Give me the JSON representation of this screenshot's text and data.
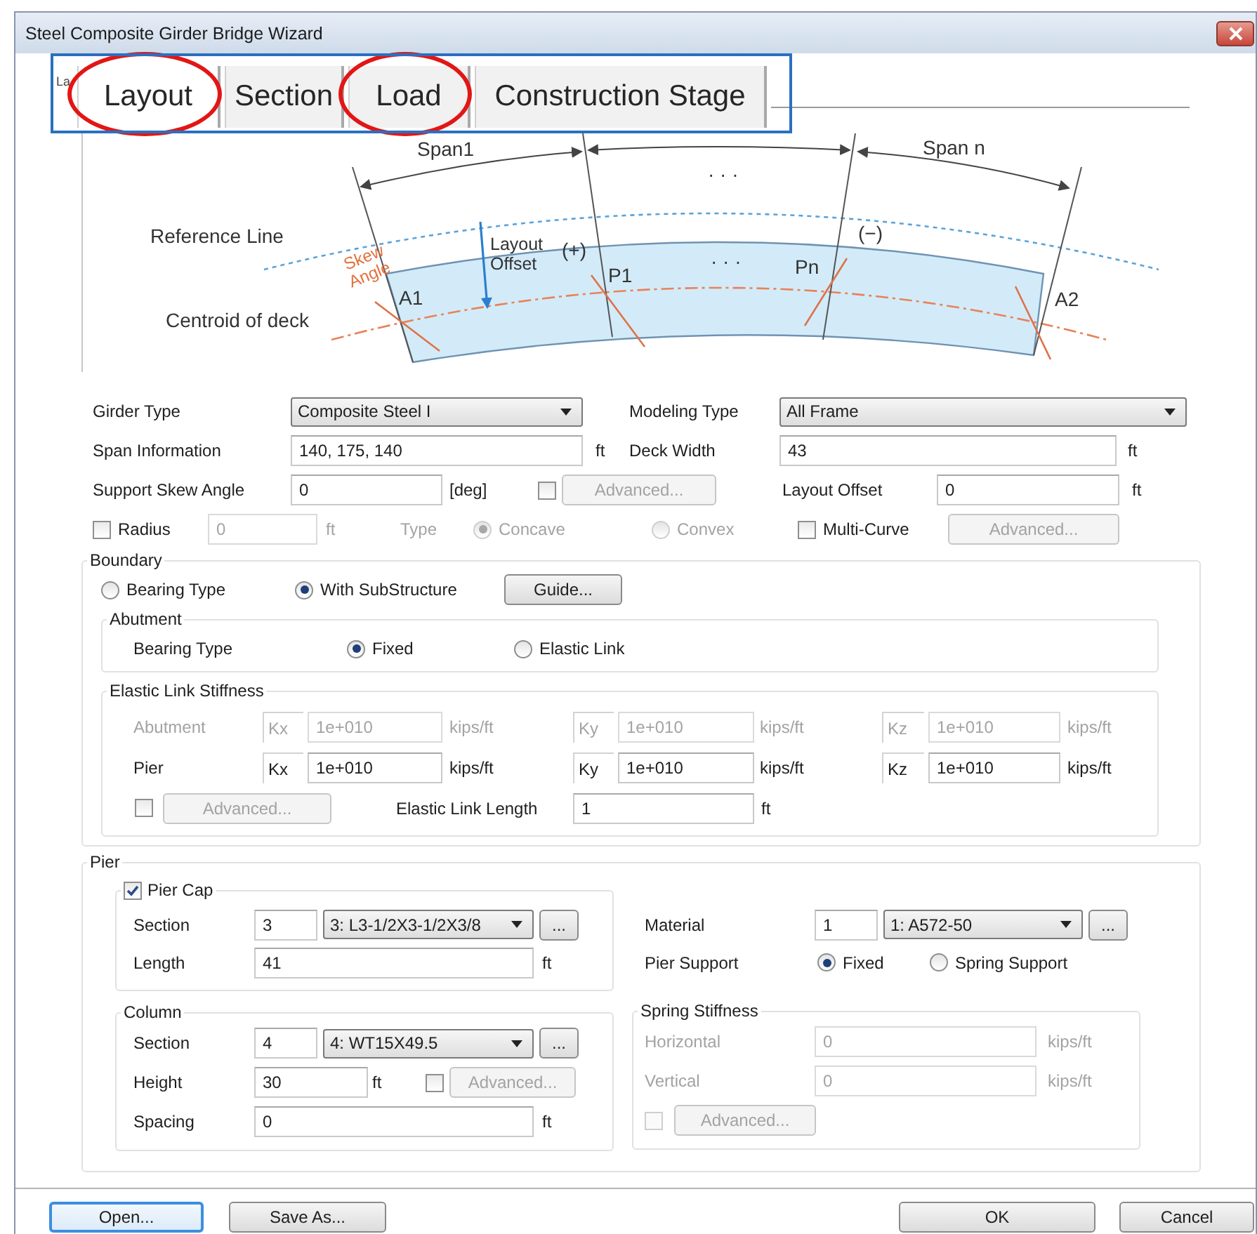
{
  "window": {
    "title": "Steel Composite Girder Bridge Wizard"
  },
  "tabs": {
    "hidden_tab_label": "La",
    "highlight_frame": true,
    "items": [
      {
        "label": "Layout",
        "selected": true,
        "circled": true
      },
      {
        "label": "Section",
        "selected": false,
        "circled": false
      },
      {
        "label": "Load",
        "selected": false,
        "circled": true
      },
      {
        "label": "Construction Stage",
        "selected": false,
        "circled": false
      }
    ]
  },
  "diagram": {
    "labels": [
      {
        "text": "Span1",
        "kind": "plain"
      },
      {
        "text": "· · ·",
        "kind": "plain"
      },
      {
        "text": "Span n",
        "kind": "plain"
      },
      {
        "text": "Reference Line",
        "kind": "plain"
      },
      {
        "text": "Layout Offset",
        "kind": "plain"
      },
      {
        "text": "(+)",
        "kind": "plain"
      },
      {
        "text": "P1",
        "kind": "plain"
      },
      {
        "text": "· · ·",
        "kind": "plain"
      },
      {
        "text": "Pn",
        "kind": "plain"
      },
      {
        "text": "(−)",
        "kind": "plain"
      },
      {
        "text": "Skew Angle",
        "kind": "angle"
      },
      {
        "text": "A1",
        "kind": "plain"
      },
      {
        "text": "A2",
        "kind": "plain"
      },
      {
        "text": "Centroid of deck",
        "kind": "plain"
      }
    ]
  },
  "general": {
    "rows": [
      {
        "cells": [
          {
            "kind": "label",
            "text": "Girder Type",
            "disabled": false
          },
          {
            "kind": "select",
            "value": "Composite Steel I",
            "disabled": false
          },
          {
            "kind": "blank"
          },
          {
            "kind": "blank"
          },
          {
            "kind": "blank"
          },
          {
            "kind": "label",
            "text": "Modeling Type",
            "disabled": false
          },
          {
            "kind": "select",
            "value": "All Frame",
            "disabled": false
          }
        ]
      },
      {
        "cells": [
          {
            "kind": "label",
            "text": "Span Information",
            "disabled": false
          },
          {
            "kind": "input",
            "value": "140, 175, 140",
            "disabled": false
          },
          {
            "kind": "blank"
          },
          {
            "kind": "blank"
          },
          {
            "kind": "label",
            "text": "ft",
            "disabled": false
          },
          {
            "kind": "label",
            "text": "Deck Width",
            "disabled": false
          },
          {
            "kind": "input",
            "value": "43",
            "disabled": false
          },
          {
            "kind": "blank"
          },
          {
            "kind": "label",
            "text": "ft",
            "disabled": false
          }
        ]
      },
      {
        "cells": [
          {
            "kind": "label",
            "text": "Support Skew Angle",
            "disabled": false
          },
          {
            "kind": "input",
            "value": "0",
            "disabled": false
          },
          {
            "kind": "label",
            "text": "[deg]",
            "disabled": false
          },
          {
            "kind": "checkbox",
            "checked": false,
            "disabled": false
          },
          {
            "kind": "button",
            "text": "Advanced...",
            "disabled": true
          },
          {
            "kind": "blank"
          },
          {
            "kind": "label",
            "text": "Layout Offset",
            "disabled": false
          },
          {
            "kind": "input",
            "value": "0",
            "disabled": false
          },
          {
            "kind": "label",
            "text": "ft",
            "disabled": false
          }
        ]
      }
    ],
    "curve_options": {
      "cells": [
        {
          "kind": "checkbox",
          "text": "Radius",
          "checked": false,
          "disabled": false
        },
        {
          "kind": "input",
          "value": "0",
          "disabled": true
        },
        {
          "kind": "label",
          "text": "ft",
          "disabled": true
        },
        {
          "kind": "label",
          "text": "Type",
          "disabled": true
        },
        {
          "kind": "radio",
          "text": "Concave",
          "selected": true,
          "disabled": true
        },
        {
          "kind": "radio",
          "text": "Convex",
          "selected": false,
          "disabled": true
        },
        {
          "kind": "checkbox",
          "text": "Multi-Curve",
          "checked": false,
          "disabled": false
        },
        {
          "kind": "button",
          "text": "Advanced...",
          "disabled": true
        }
      ]
    }
  },
  "boundary": {
    "title": "Boundary",
    "rows": [
      {
        "cells": [
          {
            "kind": "radio",
            "text": "Bearing Type",
            "selected": false,
            "disabled": false
          },
          {
            "kind": "radio",
            "text": "With SubStructure",
            "selected": true,
            "disabled": false
          },
          {
            "kind": "button",
            "text": "Guide...",
            "disabled": false
          }
        ]
      }
    ],
    "abutment": {
      "title": "Abutment",
      "rows": [
        {
          "cells": [
            {
              "kind": "label",
              "text": "Bearing Type",
              "disabled": false
            },
            {
              "kind": "radio",
              "text": "Fixed",
              "selected": true,
              "disabled": false
            },
            {
              "kind": "radio",
              "text": "Elastic Link",
              "selected": false,
              "disabled": false
            }
          ]
        }
      ]
    },
    "elastic_link_stiffness": {
      "title": "Elastic Link Stiffness",
      "rows": [
        {
          "cells": [
            {
              "kind": "label",
              "text": "Abutment",
              "disabled": true
            },
            {
              "kind": "axis",
              "text": "Kx",
              "disabled": true
            },
            {
              "kind": "input",
              "value": "1e+010",
              "disabled": true
            },
            {
              "kind": "label",
              "text": "kips/ft",
              "disabled": true
            },
            {
              "kind": "axis",
              "text": "Ky",
              "disabled": true
            },
            {
              "kind": "input",
              "value": "1e+010",
              "disabled": true
            },
            {
              "kind": "label",
              "text": "kips/ft",
              "disabled": true
            },
            {
              "kind": "axis",
              "text": "Kz",
              "disabled": true
            },
            {
              "kind": "input",
              "value": "1e+010",
              "disabled": true
            },
            {
              "kind": "label",
              "text": "kips/ft",
              "disabled": true
            }
          ]
        },
        {
          "cells": [
            {
              "kind": "label",
              "text": "Pier",
              "disabled": false
            },
            {
              "kind": "axis",
              "text": "Kx",
              "disabled": false
            },
            {
              "kind": "input",
              "value": "1e+010",
              "disabled": false
            },
            {
              "kind": "label",
              "text": "kips/ft",
              "disabled": false
            },
            {
              "kind": "axis",
              "text": "Ky",
              "disabled": false
            },
            {
              "kind": "input",
              "value": "1e+010",
              "disabled": false
            },
            {
              "kind": "label",
              "text": "kips/ft",
              "disabled": false
            },
            {
              "kind": "axis",
              "text": "Kz",
              "disabled": false
            },
            {
              "kind": "input",
              "value": "1e+010",
              "disabled": false
            },
            {
              "kind": "label",
              "text": "kips/ft",
              "disabled": false
            }
          ]
        },
        {
          "cells": [
            {
              "kind": "checkbox",
              "checked": false,
              "disabled": false
            },
            {
              "kind": "button",
              "text": "Advanced...",
              "disabled": true
            },
            {
              "kind": "blank"
            },
            {
              "kind": "label",
              "text": "Elastic Link Length",
              "disabled": false
            },
            {
              "kind": "input",
              "value": "1",
              "disabled": false
            },
            {
              "kind": "blank"
            },
            {
              "kind": "label",
              "text": "ft",
              "disabled": false
            }
          ]
        }
      ]
    }
  },
  "pier": {
    "title": "Pier",
    "pier_cap": {
      "title": "Pier Cap",
      "checked": true,
      "rows": [
        {
          "cells": [
            {
              "kind": "label",
              "text": "Section",
              "disabled": false
            },
            {
              "kind": "input",
              "value": "3",
              "disabled": false
            },
            {
              "kind": "select",
              "value": "3: L3-1/2X3-1/2X3/8",
              "disabled": false
            },
            {
              "kind": "button",
              "text": "...",
              "disabled": false
            }
          ]
        },
        {
          "cells": [
            {
              "kind": "label",
              "text": "Length",
              "disabled": false
            },
            {
              "kind": "input",
              "value": "41",
              "disabled": false
            },
            {
              "kind": "label",
              "text": "ft",
              "disabled": false
            }
          ]
        }
      ]
    },
    "support": {
      "rows": [
        {
          "cells": [
            {
              "kind": "label",
              "text": "Material",
              "disabled": false
            },
            {
              "kind": "input",
              "value": "1",
              "disabled": false
            },
            {
              "kind": "select",
              "value": "1: A572-50",
              "disabled": false
            },
            {
              "kind": "button",
              "text": "...",
              "disabled": false
            }
          ]
        },
        {
          "cells": [
            {
              "kind": "label",
              "text": "Pier Support",
              "disabled": false
            },
            {
              "kind": "radio",
              "text": "Fixed",
              "selected": true,
              "disabled": false
            },
            {
              "kind": "radio",
              "text": "Spring Support",
              "selected": false,
              "disabled": false
            }
          ]
        }
      ]
    },
    "column": {
      "title": "Column",
      "rows": [
        {
          "cells": [
            {
              "kind": "label",
              "text": "Section",
              "disabled": false
            },
            {
              "kind": "input",
              "value": "4",
              "disabled": false
            },
            {
              "kind": "select",
              "value": "4: WT15X49.5",
              "disabled": false
            },
            {
              "kind": "button",
              "text": "...",
              "disabled": false
            }
          ]
        },
        {
          "cells": [
            {
              "kind": "label",
              "text": "Height",
              "disabled": false
            },
            {
              "kind": "input",
              "value": "30",
              "disabled": false
            },
            {
              "kind": "label",
              "text": "ft",
              "disabled": false
            },
            {
              "kind": "checkbox",
              "checked": false,
              "disabled": false
            },
            {
              "kind": "button",
              "text": "Advanced...",
              "disabled": true
            }
          ]
        },
        {
          "cells": [
            {
              "kind": "label",
              "text": "Spacing",
              "disabled": false
            },
            {
              "kind": "input",
              "value": "0",
              "disabled": false
            },
            {
              "kind": "blank"
            },
            {
              "kind": "blank"
            },
            {
              "kind": "label",
              "text": "ft",
              "disabled": false
            }
          ]
        }
      ]
    },
    "spring_stiffness": {
      "title": "Spring Stiffness",
      "rows": [
        {
          "cells": [
            {
              "kind": "label",
              "text": "Horizontal",
              "disabled": true
            },
            {
              "kind": "input",
              "value": "0",
              "disabled": true
            },
            {
              "kind": "label",
              "text": "kips/ft",
              "disabled": true
            }
          ]
        },
        {
          "cells": [
            {
              "kind": "label",
              "text": "Vertical",
              "disabled": true
            },
            {
              "kind": "input",
              "value": "0",
              "disabled": true
            },
            {
              "kind": "label",
              "text": "kips/ft",
              "disabled": true
            }
          ]
        },
        {
          "cells": [
            {
              "kind": "checkbox",
              "checked": false,
              "disabled": true
            },
            {
              "kind": "button",
              "text": "Advanced...",
              "disabled": true
            }
          ]
        }
      ]
    }
  },
  "buttons": [
    {
      "label": "Open...",
      "focused": true
    },
    {
      "label": "Save As...",
      "focused": false
    },
    {
      "label": "OK",
      "focused": false
    },
    {
      "label": "Cancel",
      "focused": false
    }
  ]
}
